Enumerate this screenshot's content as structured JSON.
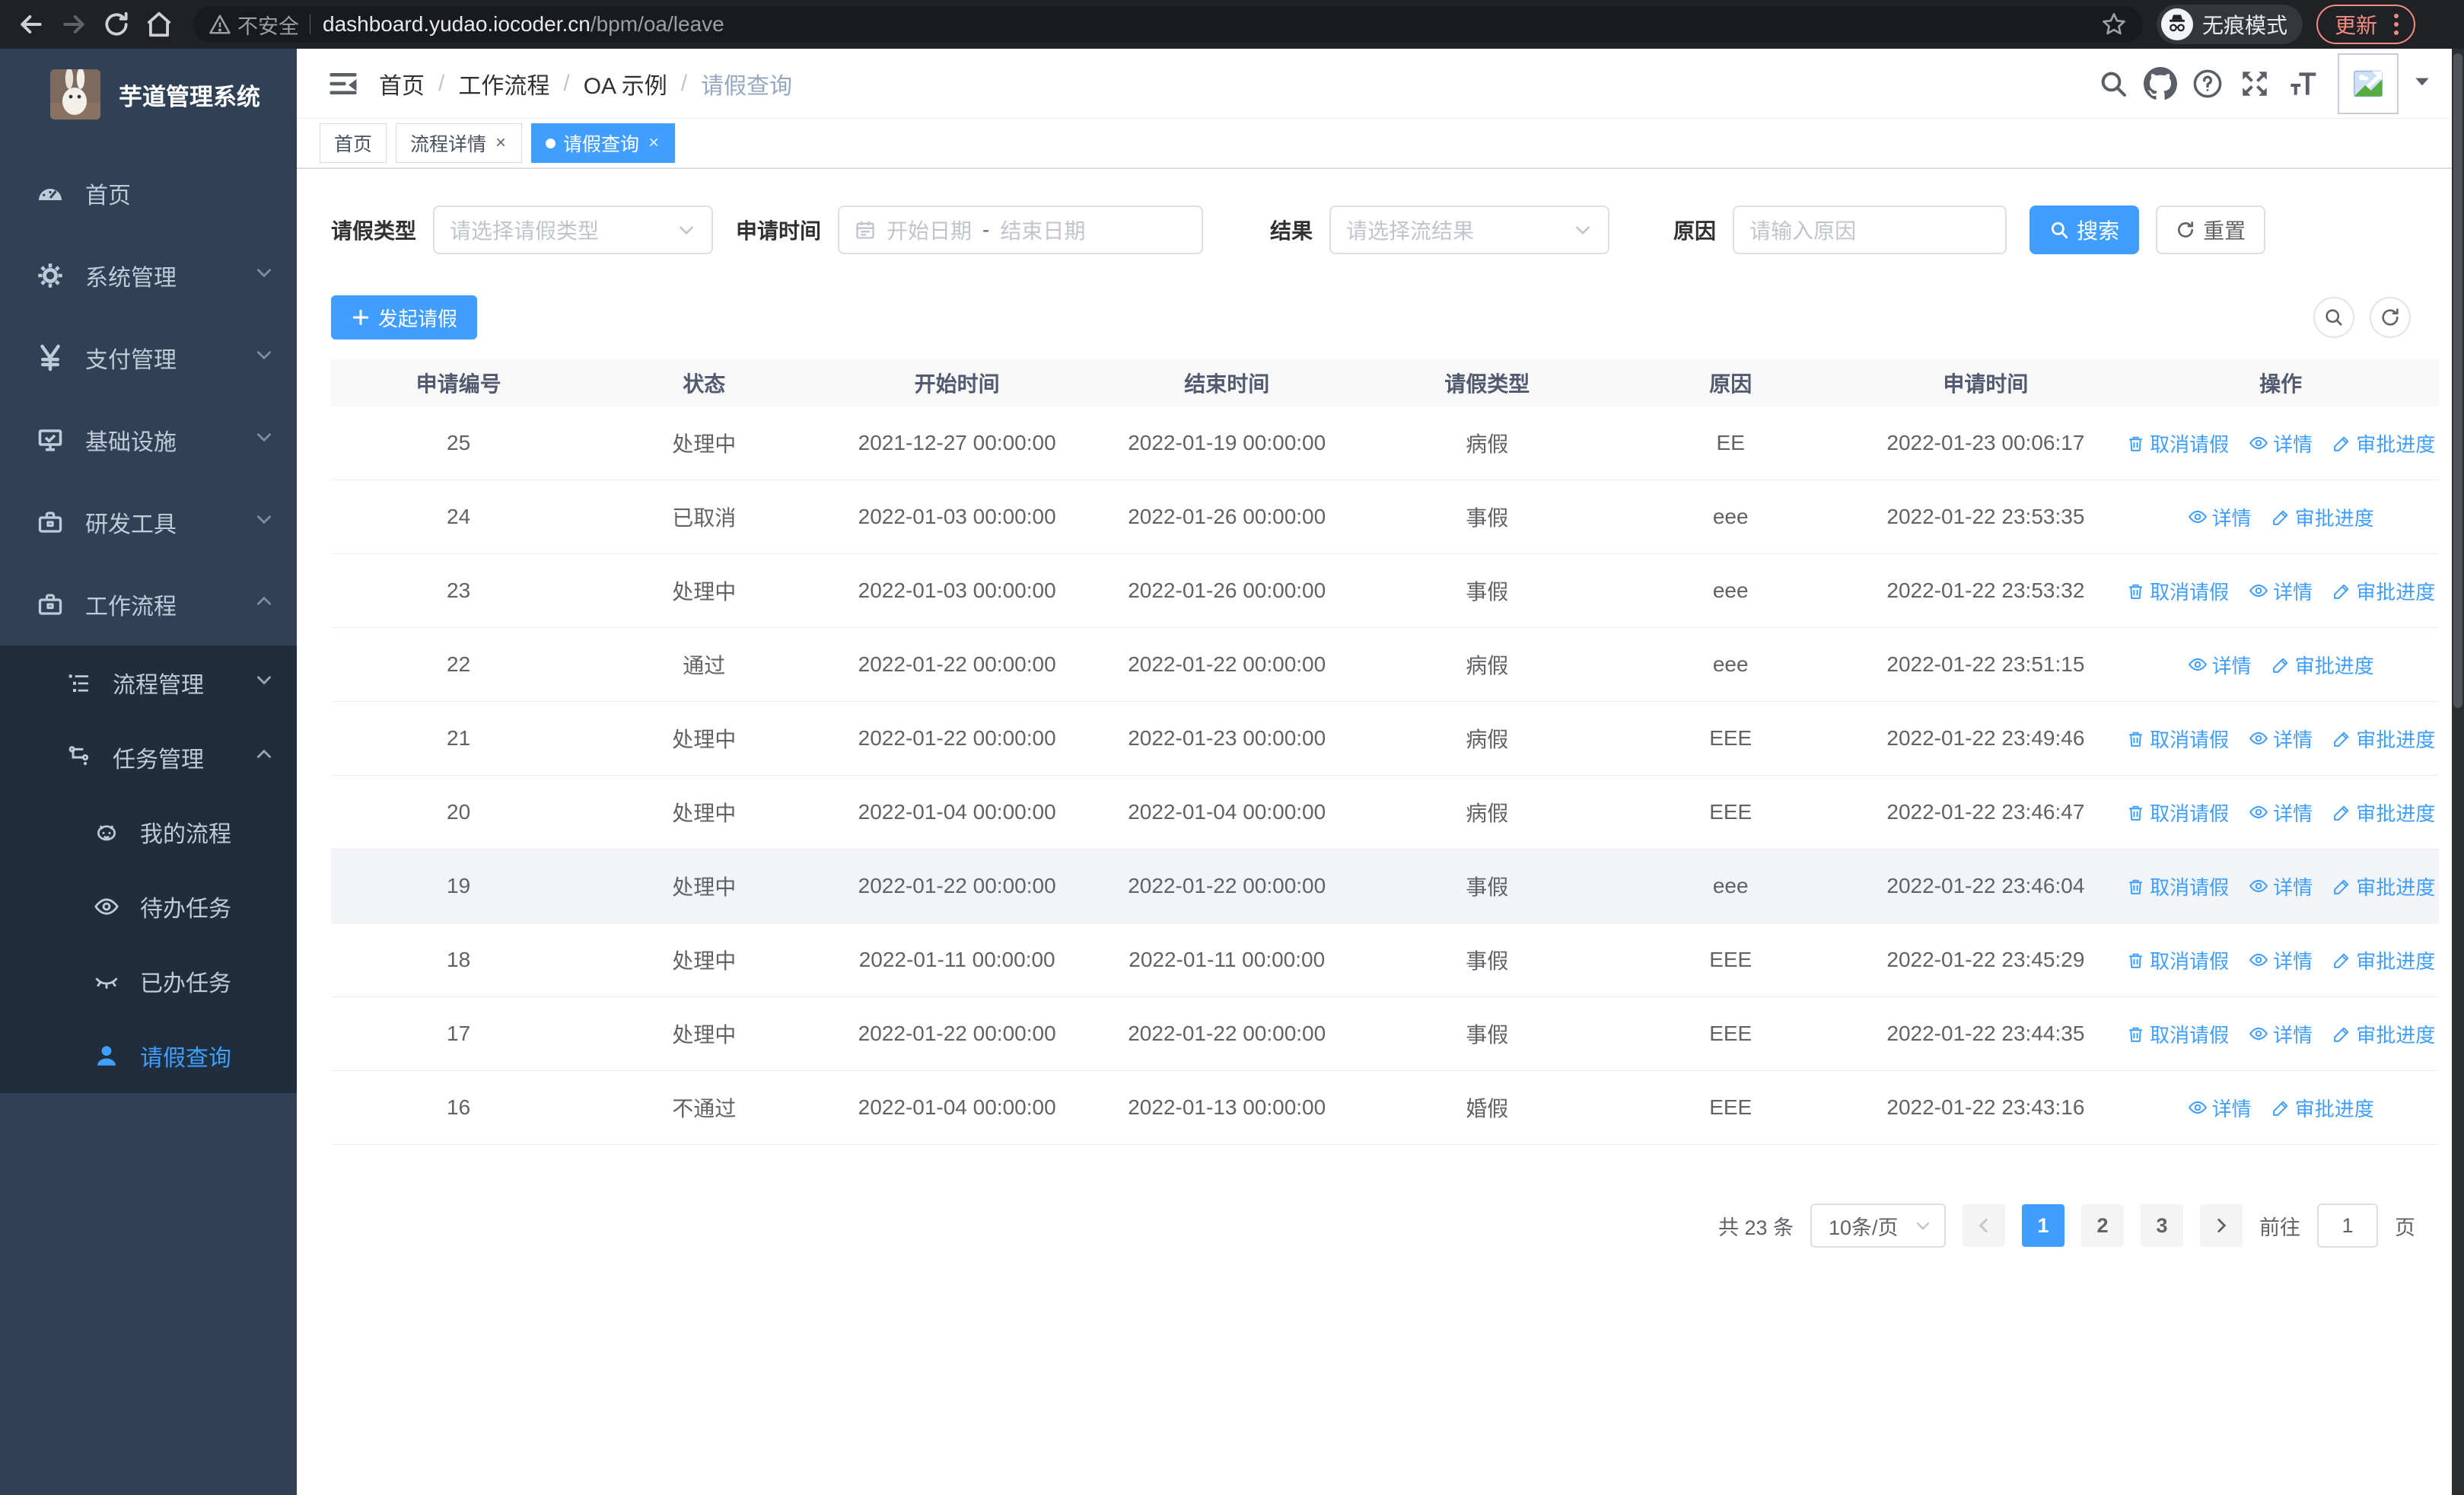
{
  "browser": {
    "security_label": "不安全",
    "url_host": "dashboard.yudao.iocoder.cn",
    "url_path": "/bpm/oa/leave",
    "incognito_label": "无痕模式",
    "update_label": "更新"
  },
  "sidebar": {
    "title": "芋道管理系统",
    "items": {
      "home": "首页",
      "system": "系统管理",
      "payment": "支付管理",
      "infra": "基础设施",
      "devtools": "研发工具",
      "workflow": "工作流程"
    },
    "workflow_children": {
      "process_mgmt": "流程管理",
      "task_mgmt": "任务管理",
      "my_process": "我的流程",
      "todo_tasks": "待办任务",
      "done_tasks": "已办任务",
      "leave_query": "请假查询"
    }
  },
  "header": {
    "breadcrumb": [
      "首页",
      "工作流程",
      "OA 示例",
      "请假查询"
    ],
    "separator": "/"
  },
  "tabs": {
    "home": "首页",
    "process_detail": "流程详情",
    "leave_query": "请假查询"
  },
  "filters": {
    "leave_type_label": "请假类型",
    "leave_type_placeholder": "请选择请假类型",
    "apply_time_label": "申请时间",
    "start_date_placeholder": "开始日期",
    "range_separator": "-",
    "end_date_placeholder": "结束日期",
    "result_label": "结果",
    "result_placeholder": "请选择流结果",
    "reason_label": "原因",
    "reason_placeholder": "请输入原因",
    "search_label": "搜索",
    "reset_label": "重置"
  },
  "toolbar": {
    "create_label": "发起请假"
  },
  "table": {
    "columns": [
      "申请编号",
      "状态",
      "开始时间",
      "结束时间",
      "请假类型",
      "原因",
      "申请时间",
      "操作"
    ],
    "action_labels": {
      "cancel": "取消请假",
      "detail": "详情",
      "progress": "审批进度"
    },
    "rows": [
      {
        "id": "25",
        "status": "处理中",
        "start": "2021-12-27 00:00:00",
        "end": "2022-01-19 00:00:00",
        "type": "病假",
        "reason": "EE",
        "apply": "2022-01-23 00:06:17",
        "actions": [
          "cancel",
          "detail",
          "progress"
        ],
        "highlight": false
      },
      {
        "id": "24",
        "status": "已取消",
        "start": "2022-01-03 00:00:00",
        "end": "2022-01-26 00:00:00",
        "type": "事假",
        "reason": "eee",
        "apply": "2022-01-22 23:53:35",
        "actions": [
          "detail",
          "progress"
        ],
        "highlight": false
      },
      {
        "id": "23",
        "status": "处理中",
        "start": "2022-01-03 00:00:00",
        "end": "2022-01-26 00:00:00",
        "type": "事假",
        "reason": "eee",
        "apply": "2022-01-22 23:53:32",
        "actions": [
          "cancel",
          "detail",
          "progress"
        ],
        "highlight": false
      },
      {
        "id": "22",
        "status": "通过",
        "start": "2022-01-22 00:00:00",
        "end": "2022-01-22 00:00:00",
        "type": "病假",
        "reason": "eee",
        "apply": "2022-01-22 23:51:15",
        "actions": [
          "detail",
          "progress"
        ],
        "highlight": false
      },
      {
        "id": "21",
        "status": "处理中",
        "start": "2022-01-22 00:00:00",
        "end": "2022-01-23 00:00:00",
        "type": "病假",
        "reason": "EEE",
        "apply": "2022-01-22 23:49:46",
        "actions": [
          "cancel",
          "detail",
          "progress"
        ],
        "highlight": false
      },
      {
        "id": "20",
        "status": "处理中",
        "start": "2022-01-04 00:00:00",
        "end": "2022-01-04 00:00:00",
        "type": "病假",
        "reason": "EEE",
        "apply": "2022-01-22 23:46:47",
        "actions": [
          "cancel",
          "detail",
          "progress"
        ],
        "highlight": false
      },
      {
        "id": "19",
        "status": "处理中",
        "start": "2022-01-22 00:00:00",
        "end": "2022-01-22 00:00:00",
        "type": "事假",
        "reason": "eee",
        "apply": "2022-01-22 23:46:04",
        "actions": [
          "cancel",
          "detail",
          "progress"
        ],
        "highlight": true
      },
      {
        "id": "18",
        "status": "处理中",
        "start": "2022-01-11 00:00:00",
        "end": "2022-01-11 00:00:00",
        "type": "事假",
        "reason": "EEE",
        "apply": "2022-01-22 23:45:29",
        "actions": [
          "cancel",
          "detail",
          "progress"
        ],
        "highlight": false
      },
      {
        "id": "17",
        "status": "处理中",
        "start": "2022-01-22 00:00:00",
        "end": "2022-01-22 00:00:00",
        "type": "事假",
        "reason": "EEE",
        "apply": "2022-01-22 23:44:35",
        "actions": [
          "cancel",
          "detail",
          "progress"
        ],
        "highlight": false
      },
      {
        "id": "16",
        "status": "不通过",
        "start": "2022-01-04 00:00:00",
        "end": "2022-01-13 00:00:00",
        "type": "婚假",
        "reason": "EEE",
        "apply": "2022-01-22 23:43:16",
        "actions": [
          "detail",
          "progress"
        ],
        "highlight": false
      }
    ]
  },
  "pagination": {
    "total_label": "共 23 条",
    "page_size_label": "10条/页",
    "pages": [
      "1",
      "2",
      "3"
    ],
    "goto_label": "前往",
    "goto_value": "1",
    "goto_suffix": "页"
  },
  "colors": {
    "accent": "#409eff",
    "sidebar_bg": "#304156",
    "submenu_bg": "#1f2d3d",
    "update_red": "#f28b82",
    "table_header_bg": "#f8f8f9"
  }
}
